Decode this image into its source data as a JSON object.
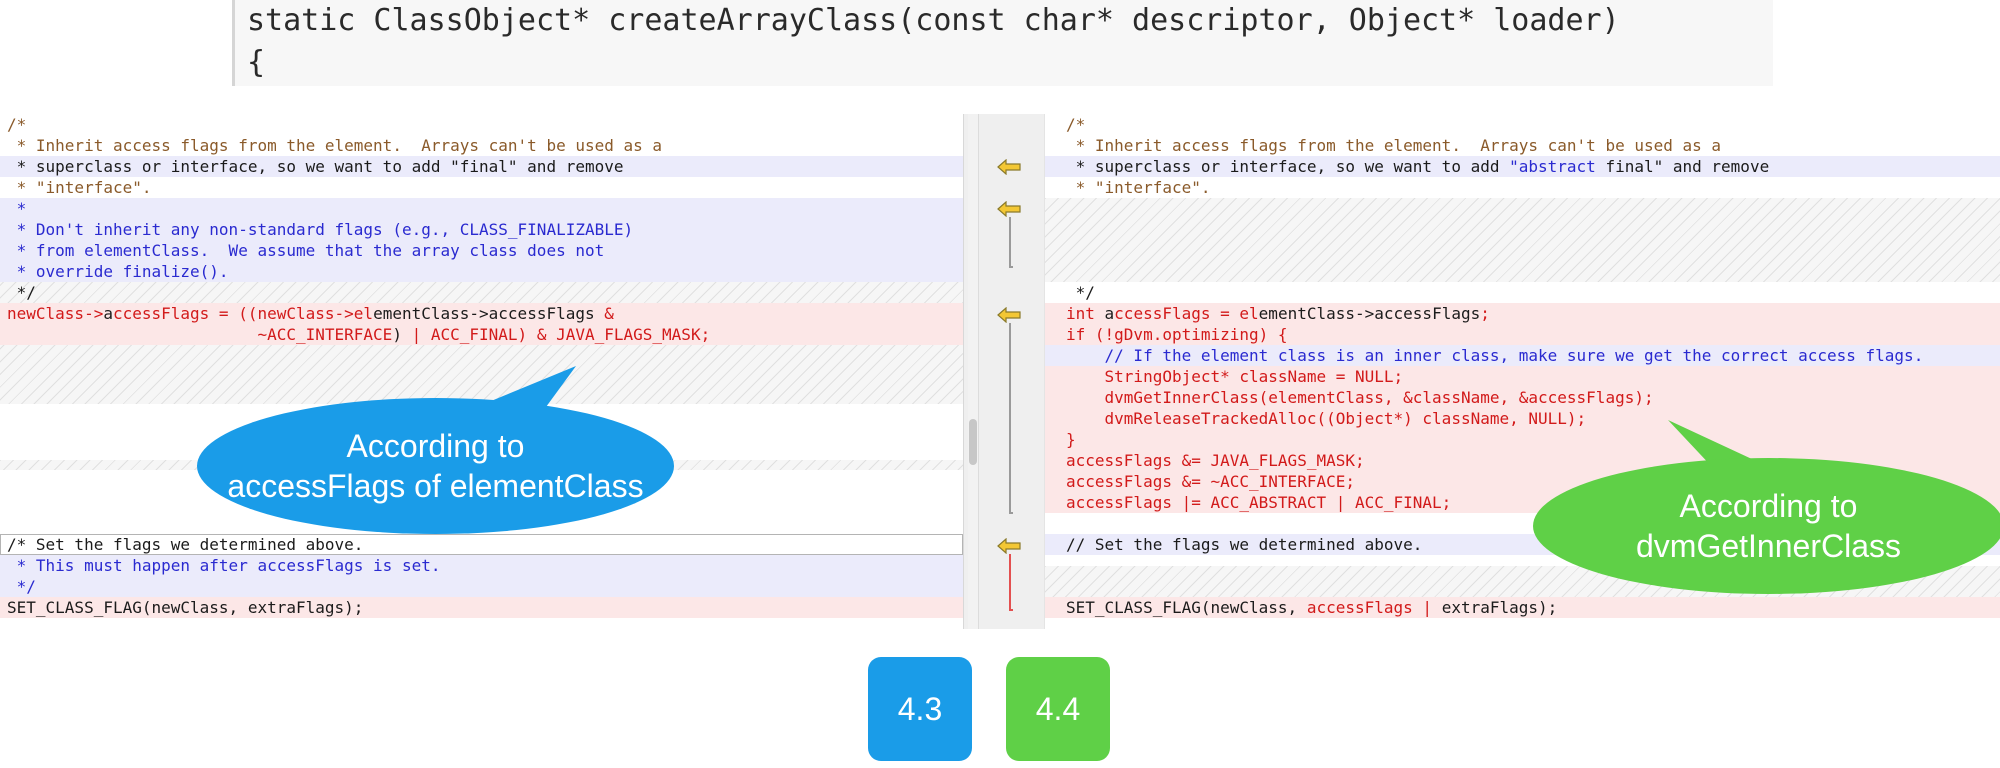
{
  "header": {
    "signature": "static ClassObject* createArrayClass(const char* descriptor, Object* loader)",
    "brace": "{"
  },
  "left_pane": [
    [
      [
        "c-comment",
        "/*"
      ]
    ],
    [
      [
        "c-comment",
        " * Inherit access flags from the element.  Arrays can't be used as a"
      ]
    ],
    [
      [
        "c-black",
        " * superclass or interface, so we want to add \"final\" and remove"
      ]
    ],
    [
      [
        "c-comment",
        " * \"interface\"."
      ]
    ],
    [
      [
        "c-blue",
        " *"
      ]
    ],
    [
      [
        "c-blue",
        " * Don't inherit any non-standard flags (e.g., CLASS_FINALIZABLE)"
      ]
    ],
    [
      [
        "c-blue",
        " * from elementClass.  We assume that the array class does not"
      ]
    ],
    [
      [
        "c-blue",
        " * override finalize()."
      ]
    ],
    [
      [
        "c-black",
        " */"
      ]
    ],
    [
      [
        "c-red",
        "newClass->"
      ],
      [
        "c-black",
        "a"
      ],
      [
        "c-red",
        "ccessFlags = ((newClass->el"
      ],
      [
        "c-black",
        "ementClass->accessFlags "
      ],
      [
        "c-red",
        "&"
      ]
    ],
    [
      [
        "c-red",
        "                          ~ACC_INTERFACE"
      ],
      [
        "c-black",
        ")"
      ],
      [
        "c-red",
        " | ACC_FINAL) & JAVA_FLAGS_MASK;"
      ]
    ],
    [
      [
        "c-black",
        "/* Set the flags we determined above."
      ]
    ],
    [
      [
        "c-blue",
        " * This must happen after accessFlags is set."
      ]
    ],
    [
      [
        "c-blue",
        " */"
      ]
    ],
    [
      [
        "c-black",
        "SET_CLASS_FLAG(newClass, extraFlags);"
      ]
    ]
  ],
  "right_pane": [
    [
      [
        "c-comment",
        "/*"
      ]
    ],
    [
      [
        "c-comment",
        " * Inherit access flags from the element.  Arrays can't be used as a"
      ]
    ],
    [
      [
        "c-black",
        " * superclass or interface, so we want to add "
      ],
      [
        "c-blue",
        "\"abstract"
      ],
      [
        "c-black",
        " final\" and remove"
      ]
    ],
    [
      [
        "c-comment",
        " * \"interface\"."
      ]
    ],
    [
      [
        "c-black",
        " */"
      ]
    ],
    [
      [
        "c-red",
        "int "
      ],
      [
        "c-black",
        "a"
      ],
      [
        "c-red",
        "ccessFlags = el"
      ],
      [
        "c-black",
        "ementClass->accessFlags"
      ],
      [
        "c-red",
        ";"
      ]
    ],
    [
      [
        "c-red",
        "if (!gDvm.optimizing) {"
      ]
    ],
    [
      [
        "c-blue",
        "    // If the element class is an inner class, make sure we get the correct access flags."
      ]
    ],
    [
      [
        "c-red",
        "    StringObject* className = NULL;"
      ]
    ],
    [
      [
        "c-red",
        "    dvmGetInnerClass(elementClass, &className, &accessFlags);"
      ]
    ],
    [
      [
        "c-red",
        "    dvmReleaseTrackedAlloc((Object*) className, NULL);"
      ]
    ],
    [
      [
        "c-red",
        "}"
      ]
    ],
    [
      [
        "c-red",
        "accessFlags &= JAVA_FLAGS_MASK;"
      ]
    ],
    [
      [
        "c-red",
        "accessFlags &= ~ACC_INTERFACE;"
      ]
    ],
    [
      [
        "c-red",
        "accessFlags |= ACC_ABSTRACT | ACC_FINAL;"
      ]
    ],
    [
      [
        "c-black",
        "// Set the flags we determined above."
      ]
    ],
    [
      [
        "c-black",
        "SET_CLASS_FLAG(newClass, "
      ],
      [
        "c-red",
        "accessFlags | "
      ],
      [
        "c-black",
        "extraFlags);"
      ]
    ]
  ],
  "annotations": {
    "left": [
      "According to",
      "accessFlags of elementClass"
    ],
    "right": [
      "According to",
      "dvmGetInnerClass"
    ]
  },
  "versions": {
    "old": "4.3",
    "new": "4.4"
  },
  "colors": {
    "blue_accent": "#1a9ce8",
    "green_accent": "#5fd047",
    "deleted_bg": "#fce7e7",
    "changed_bg": "#ebebfb",
    "arrow_fill": "#f3c734"
  }
}
